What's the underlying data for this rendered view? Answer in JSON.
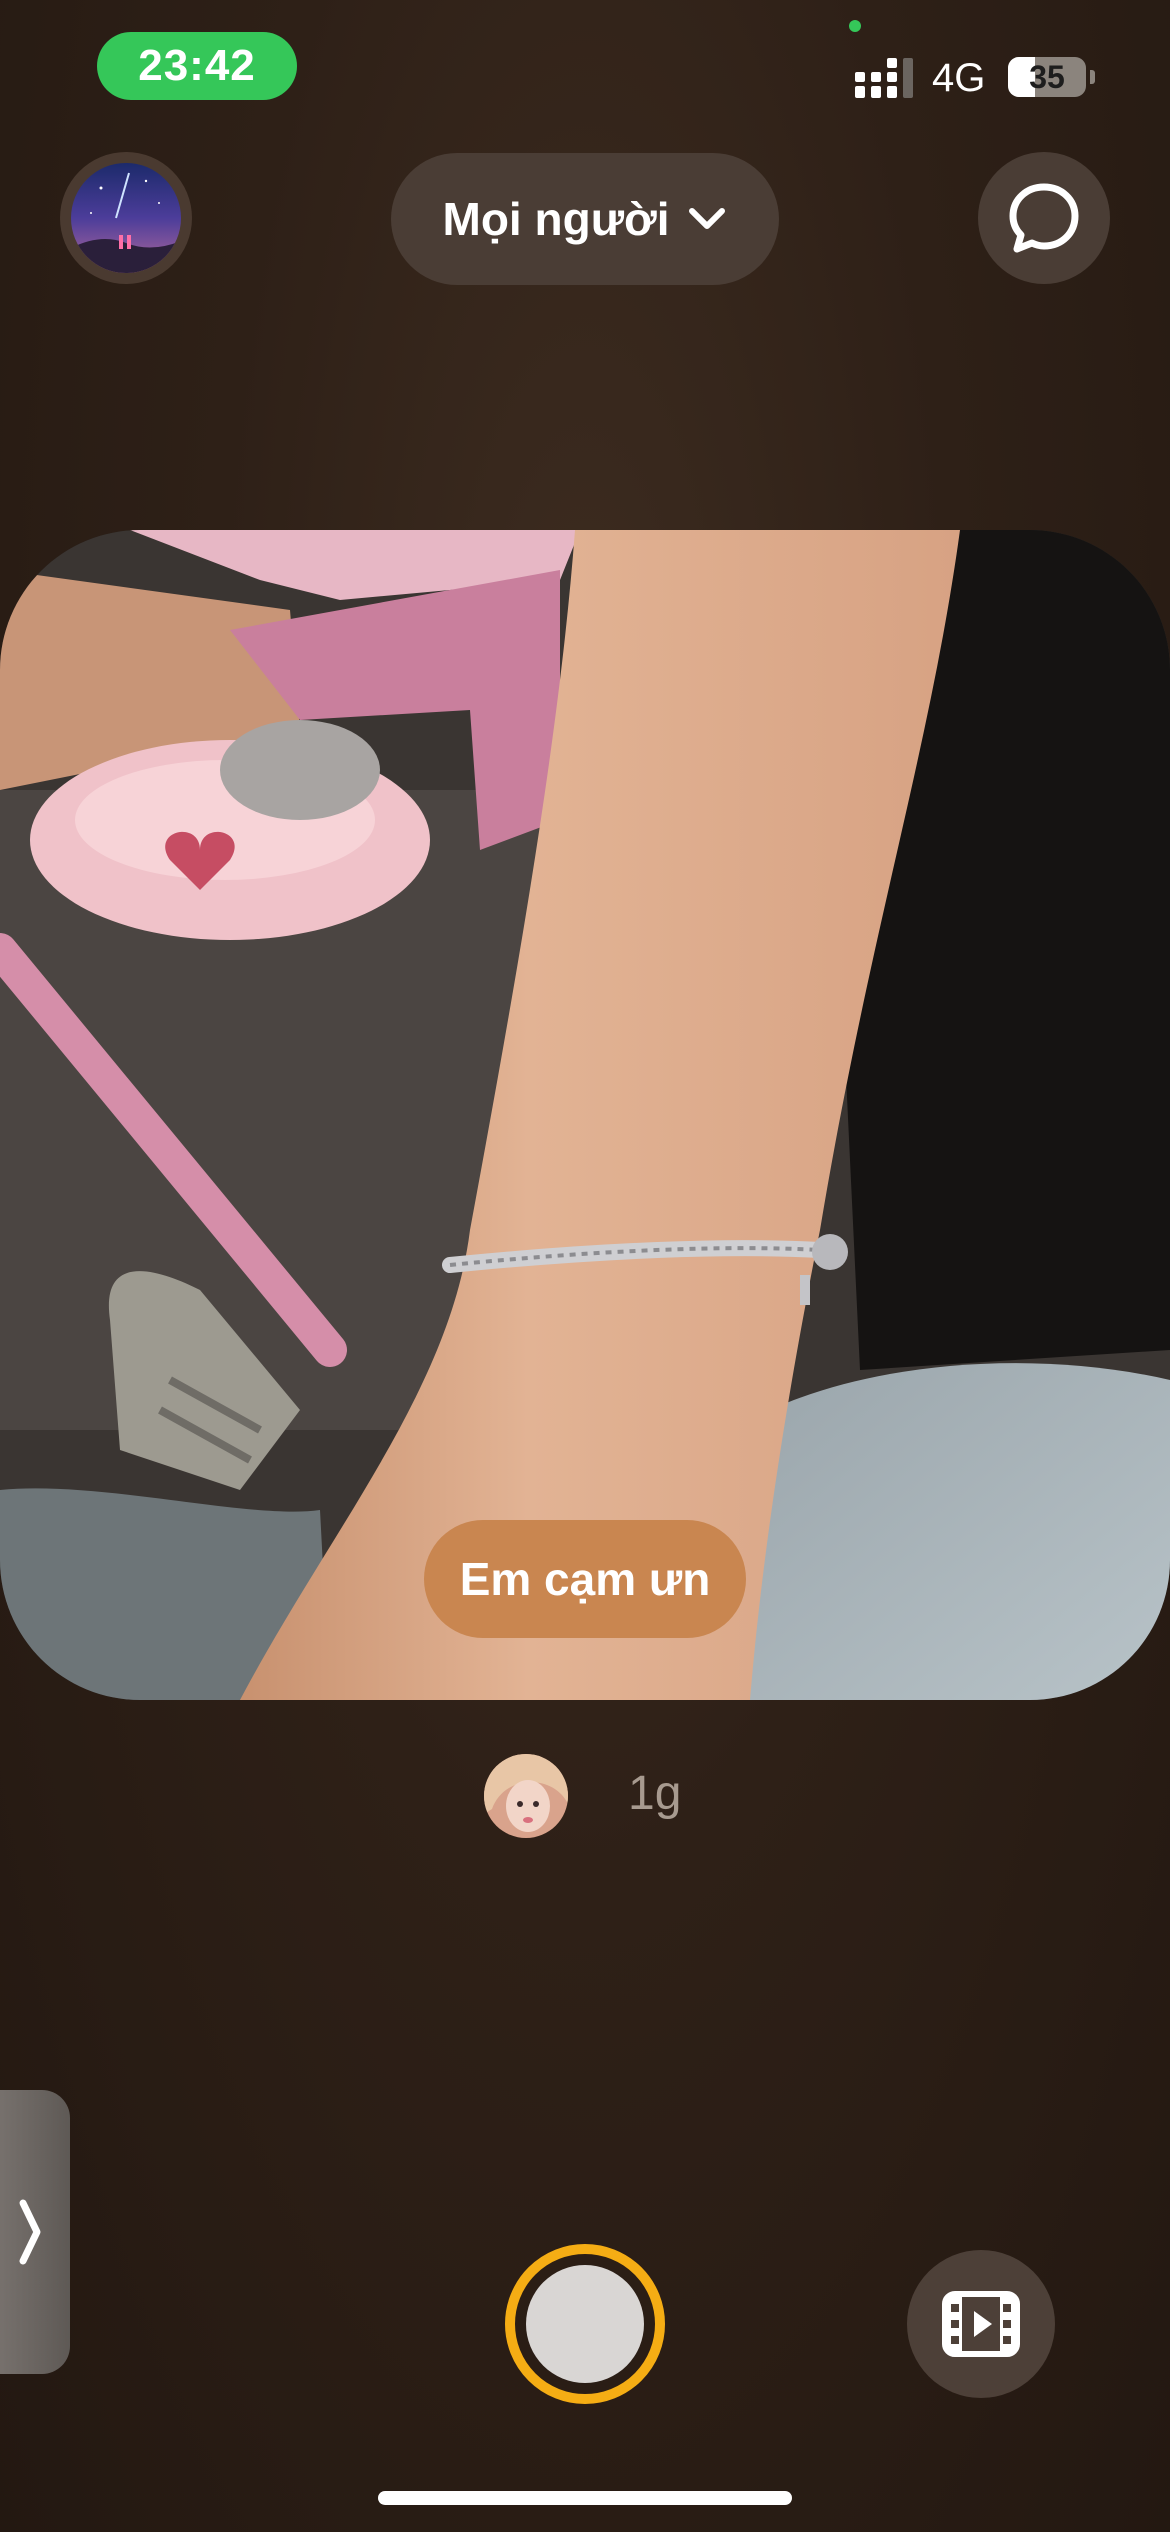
{
  "status_bar": {
    "time": "23:42",
    "network": "4G",
    "battery_level": "35",
    "battery_fraction": 0.35
  },
  "header": {
    "audience_label": "Mọi người",
    "profile_icon": "profile-avatar-icon",
    "chevron_icon": "chevron-down-icon",
    "chat_icon": "chat-bubble-icon"
  },
  "post": {
    "caption": "Em cạm ưn",
    "age": "1g"
  },
  "controls": {
    "side_tab_icon": "chevron-right-icon",
    "shutter_icon": "shutter-icon",
    "video_icon": "film-icon",
    "shutter_ring_color": "#f5ad14",
    "time_pill_color": "#35c759"
  }
}
